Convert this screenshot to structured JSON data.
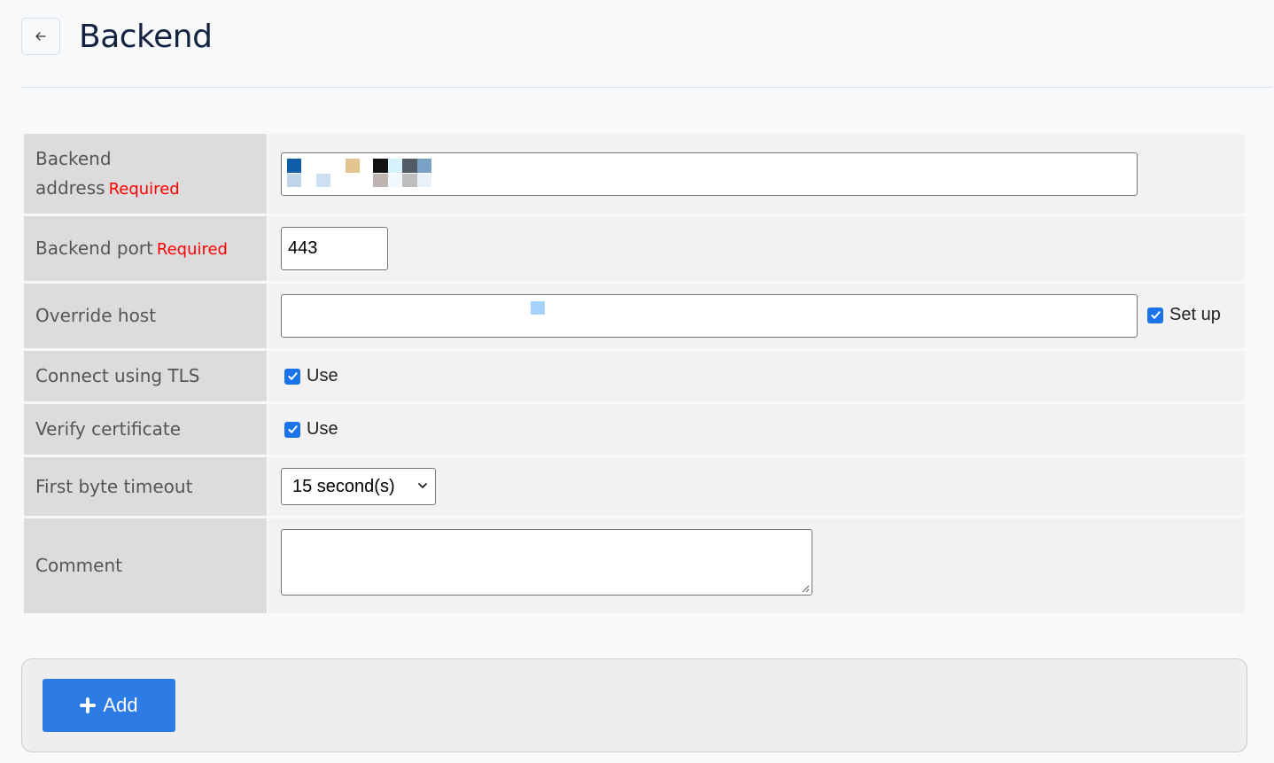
{
  "header": {
    "back_icon": "arrow-left-icon",
    "title": "Backend"
  },
  "form": {
    "required_label": "Required",
    "rows": {
      "address": {
        "label_line1": "Backend",
        "label_line2": "address",
        "required": true,
        "value_redacted": true
      },
      "port": {
        "label": "Backend port",
        "required": true,
        "value": "443"
      },
      "override_host": {
        "label": "Override host",
        "value_redacted": true,
        "setup_checkbox_label": "Set up",
        "setup_checked": true
      },
      "tls": {
        "label": "Connect using TLS",
        "checkbox_label": "Use",
        "checked": true
      },
      "verify": {
        "label": "Verify certificate",
        "checkbox_label": "Use",
        "checked": true
      },
      "timeout": {
        "label": "First byte timeout",
        "selected": "15 second(s)"
      },
      "comment": {
        "label": "Comment",
        "value": ""
      }
    }
  },
  "footer": {
    "add_button_label": "Add",
    "add_icon": "plus-icon"
  },
  "colors": {
    "accent": "#2d7be5",
    "checkbox": "#1a73e8",
    "required": "#ff0000",
    "title": "#13223f"
  }
}
